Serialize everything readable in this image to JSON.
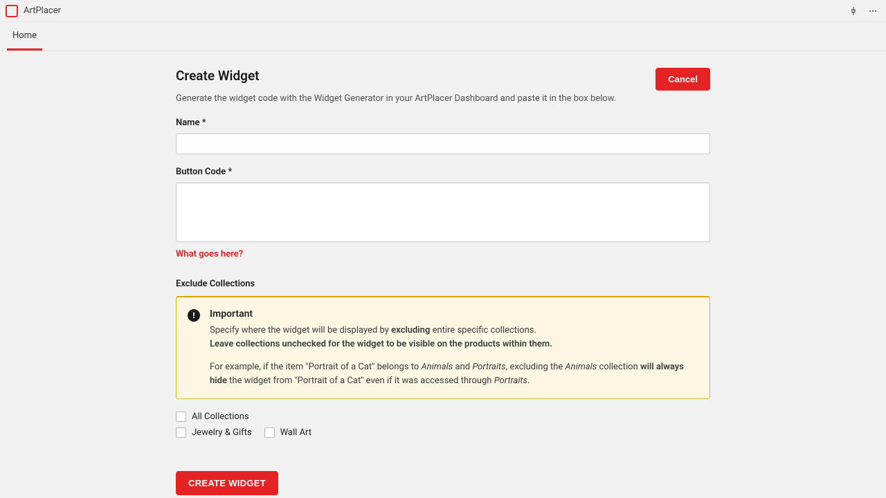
{
  "topbar": {
    "brand": "ArtPlacer"
  },
  "tabs": {
    "home": "Home"
  },
  "page": {
    "title": "Create Widget",
    "subtitle": "Generate the widget code with the Widget Generator in your ArtPlacer Dashboard and paste it in the box below.",
    "cancel": "Cancel",
    "submit": "Create Widget"
  },
  "form": {
    "name_label": "Name *",
    "name_value": "",
    "code_label": "Button Code *",
    "code_value": "",
    "help_link": "What goes here?"
  },
  "exclude": {
    "label": "Exclude Collections",
    "banner_title": "Important",
    "banner_p1a": "Specify where the widget will be displayed by ",
    "banner_p1b": "excluding",
    "banner_p1c": " entire specific collections.",
    "banner_p2": "Leave collections unchecked for the widget to be visible on the products within them.",
    "banner_p3a": "For example, if the item \"Portrait of a Cat\" belongs to ",
    "banner_p3b": "Animals",
    "banner_p3c": " and ",
    "banner_p3d": "Portraits",
    "banner_p3e": ", excluding the ",
    "banner_p3f": "Animals",
    "banner_p3g": " collection ",
    "banner_p3h": "will always hide",
    "banner_p3i": " the widget from \"Portrait of a Cat\" even if it was accessed through ",
    "banner_p3j": "Portraits",
    "banner_p3k": "."
  },
  "collections": {
    "all": "All Collections",
    "item1": "Jewelry & Gifts",
    "item2": "Wall Art"
  }
}
